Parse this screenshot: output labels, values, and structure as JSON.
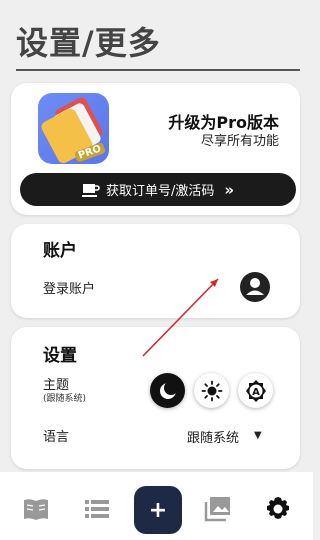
{
  "header": {
    "title": "设置/更多"
  },
  "pro": {
    "title": "升级为Pro版本",
    "subtitle": "尽享所有功能",
    "badge": "PRO",
    "order_button": "获取订单号/激活码",
    "order_chevron": "»"
  },
  "account": {
    "title": "账户",
    "login_label": "登录账户",
    "icon": "account-circle-icon"
  },
  "settings": {
    "title": "设置",
    "theme_label": "主题",
    "theme_sub": "(跟随系统)",
    "theme_options": [
      "dark-mode-icon",
      "light-mode-icon",
      "auto-mode-icon"
    ],
    "auto_letter": "A",
    "language_label": "语言",
    "language_value": "跟随系统",
    "language_caret": "▼"
  },
  "nav": {
    "items": [
      "book-icon",
      "list-icon",
      "add-icon",
      "gallery-icon",
      "gear-icon"
    ],
    "fab_label": "+"
  },
  "colors": {
    "background": "#efefef",
    "fab": "#1e2a45",
    "annotation_arrow": "#d6272c",
    "dark_button": "#1b1b1b"
  }
}
